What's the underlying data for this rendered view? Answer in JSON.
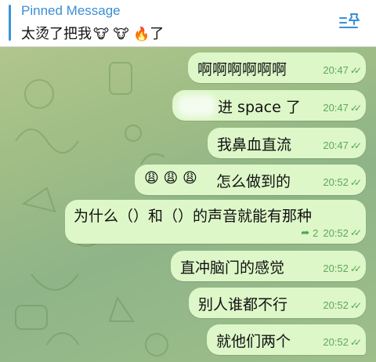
{
  "pinned": {
    "title": "Pinned Message",
    "text": "太烫了把我",
    "emojis": "🐮 🐮 🔥",
    "suffix": "了"
  },
  "messages": [
    {
      "text": "啊啊啊啊啊啊",
      "time": "20:47"
    },
    {
      "text": "进 space 了",
      "time": "20:47"
    },
    {
      "text": "我鼻血直流",
      "time": "20:47"
    },
    {
      "emojis": "😩 😩 😩",
      "text": "怎么做到的",
      "time": "20:52"
    },
    {
      "text": "为什么（）和（）的声音就能有那种",
      "replies": "2",
      "time": "20:52"
    },
    {
      "text": "直冲脑门的感觉",
      "time": "20:52"
    },
    {
      "text": "别人谁都不行",
      "time": "20:52"
    },
    {
      "text": "就他们两个",
      "time": "20:52"
    }
  ],
  "colors": {
    "accent": "#3a8fd6",
    "bubble": "#ddf7c8",
    "meta": "#5fa85a"
  },
  "icons": [
    "pin-list-icon",
    "double-check-icon",
    "forward-reply-icon"
  ]
}
